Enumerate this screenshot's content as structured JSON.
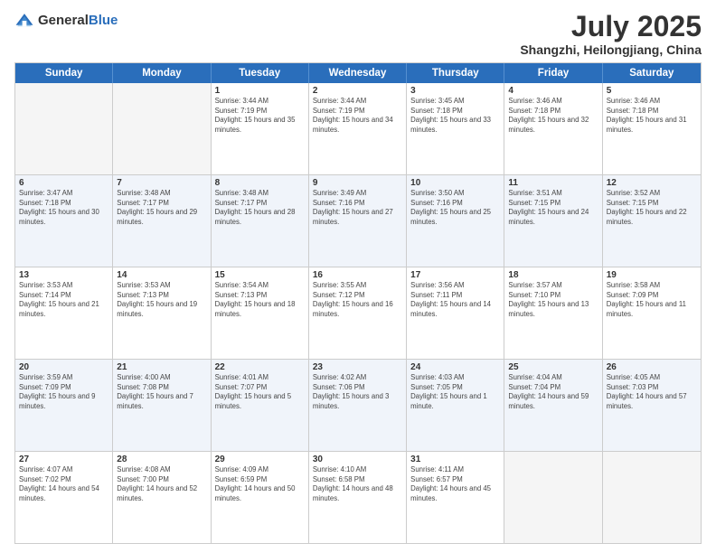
{
  "header": {
    "logo_general": "General",
    "logo_blue": "Blue",
    "title": "July 2025",
    "location": "Shangzhi, Heilongjiang, China"
  },
  "days_of_week": [
    "Sunday",
    "Monday",
    "Tuesday",
    "Wednesday",
    "Thursday",
    "Friday",
    "Saturday"
  ],
  "weeks": [
    [
      {
        "day": "",
        "sunrise": "",
        "sunset": "",
        "daylight": "",
        "empty": true
      },
      {
        "day": "",
        "sunrise": "",
        "sunset": "",
        "daylight": "",
        "empty": true
      },
      {
        "day": "1",
        "sunrise": "Sunrise: 3:44 AM",
        "sunset": "Sunset: 7:19 PM",
        "daylight": "Daylight: 15 hours and 35 minutes.",
        "empty": false
      },
      {
        "day": "2",
        "sunrise": "Sunrise: 3:44 AM",
        "sunset": "Sunset: 7:19 PM",
        "daylight": "Daylight: 15 hours and 34 minutes.",
        "empty": false
      },
      {
        "day": "3",
        "sunrise": "Sunrise: 3:45 AM",
        "sunset": "Sunset: 7:18 PM",
        "daylight": "Daylight: 15 hours and 33 minutes.",
        "empty": false
      },
      {
        "day": "4",
        "sunrise": "Sunrise: 3:46 AM",
        "sunset": "Sunset: 7:18 PM",
        "daylight": "Daylight: 15 hours and 32 minutes.",
        "empty": false
      },
      {
        "day": "5",
        "sunrise": "Sunrise: 3:46 AM",
        "sunset": "Sunset: 7:18 PM",
        "daylight": "Daylight: 15 hours and 31 minutes.",
        "empty": false
      }
    ],
    [
      {
        "day": "6",
        "sunrise": "Sunrise: 3:47 AM",
        "sunset": "Sunset: 7:18 PM",
        "daylight": "Daylight: 15 hours and 30 minutes.",
        "empty": false
      },
      {
        "day": "7",
        "sunrise": "Sunrise: 3:48 AM",
        "sunset": "Sunset: 7:17 PM",
        "daylight": "Daylight: 15 hours and 29 minutes.",
        "empty": false
      },
      {
        "day": "8",
        "sunrise": "Sunrise: 3:48 AM",
        "sunset": "Sunset: 7:17 PM",
        "daylight": "Daylight: 15 hours and 28 minutes.",
        "empty": false
      },
      {
        "day": "9",
        "sunrise": "Sunrise: 3:49 AM",
        "sunset": "Sunset: 7:16 PM",
        "daylight": "Daylight: 15 hours and 27 minutes.",
        "empty": false
      },
      {
        "day": "10",
        "sunrise": "Sunrise: 3:50 AM",
        "sunset": "Sunset: 7:16 PM",
        "daylight": "Daylight: 15 hours and 25 minutes.",
        "empty": false
      },
      {
        "day": "11",
        "sunrise": "Sunrise: 3:51 AM",
        "sunset": "Sunset: 7:15 PM",
        "daylight": "Daylight: 15 hours and 24 minutes.",
        "empty": false
      },
      {
        "day": "12",
        "sunrise": "Sunrise: 3:52 AM",
        "sunset": "Sunset: 7:15 PM",
        "daylight": "Daylight: 15 hours and 22 minutes.",
        "empty": false
      }
    ],
    [
      {
        "day": "13",
        "sunrise": "Sunrise: 3:53 AM",
        "sunset": "Sunset: 7:14 PM",
        "daylight": "Daylight: 15 hours and 21 minutes.",
        "empty": false
      },
      {
        "day": "14",
        "sunrise": "Sunrise: 3:53 AM",
        "sunset": "Sunset: 7:13 PM",
        "daylight": "Daylight: 15 hours and 19 minutes.",
        "empty": false
      },
      {
        "day": "15",
        "sunrise": "Sunrise: 3:54 AM",
        "sunset": "Sunset: 7:13 PM",
        "daylight": "Daylight: 15 hours and 18 minutes.",
        "empty": false
      },
      {
        "day": "16",
        "sunrise": "Sunrise: 3:55 AM",
        "sunset": "Sunset: 7:12 PM",
        "daylight": "Daylight: 15 hours and 16 minutes.",
        "empty": false
      },
      {
        "day": "17",
        "sunrise": "Sunrise: 3:56 AM",
        "sunset": "Sunset: 7:11 PM",
        "daylight": "Daylight: 15 hours and 14 minutes.",
        "empty": false
      },
      {
        "day": "18",
        "sunrise": "Sunrise: 3:57 AM",
        "sunset": "Sunset: 7:10 PM",
        "daylight": "Daylight: 15 hours and 13 minutes.",
        "empty": false
      },
      {
        "day": "19",
        "sunrise": "Sunrise: 3:58 AM",
        "sunset": "Sunset: 7:09 PM",
        "daylight": "Daylight: 15 hours and 11 minutes.",
        "empty": false
      }
    ],
    [
      {
        "day": "20",
        "sunrise": "Sunrise: 3:59 AM",
        "sunset": "Sunset: 7:09 PM",
        "daylight": "Daylight: 15 hours and 9 minutes.",
        "empty": false
      },
      {
        "day": "21",
        "sunrise": "Sunrise: 4:00 AM",
        "sunset": "Sunset: 7:08 PM",
        "daylight": "Daylight: 15 hours and 7 minutes.",
        "empty": false
      },
      {
        "day": "22",
        "sunrise": "Sunrise: 4:01 AM",
        "sunset": "Sunset: 7:07 PM",
        "daylight": "Daylight: 15 hours and 5 minutes.",
        "empty": false
      },
      {
        "day": "23",
        "sunrise": "Sunrise: 4:02 AM",
        "sunset": "Sunset: 7:06 PM",
        "daylight": "Daylight: 15 hours and 3 minutes.",
        "empty": false
      },
      {
        "day": "24",
        "sunrise": "Sunrise: 4:03 AM",
        "sunset": "Sunset: 7:05 PM",
        "daylight": "Daylight: 15 hours and 1 minute.",
        "empty": false
      },
      {
        "day": "25",
        "sunrise": "Sunrise: 4:04 AM",
        "sunset": "Sunset: 7:04 PM",
        "daylight": "Daylight: 14 hours and 59 minutes.",
        "empty": false
      },
      {
        "day": "26",
        "sunrise": "Sunrise: 4:05 AM",
        "sunset": "Sunset: 7:03 PM",
        "daylight": "Daylight: 14 hours and 57 minutes.",
        "empty": false
      }
    ],
    [
      {
        "day": "27",
        "sunrise": "Sunrise: 4:07 AM",
        "sunset": "Sunset: 7:02 PM",
        "daylight": "Daylight: 14 hours and 54 minutes.",
        "empty": false
      },
      {
        "day": "28",
        "sunrise": "Sunrise: 4:08 AM",
        "sunset": "Sunset: 7:00 PM",
        "daylight": "Daylight: 14 hours and 52 minutes.",
        "empty": false
      },
      {
        "day": "29",
        "sunrise": "Sunrise: 4:09 AM",
        "sunset": "Sunset: 6:59 PM",
        "daylight": "Daylight: 14 hours and 50 minutes.",
        "empty": false
      },
      {
        "day": "30",
        "sunrise": "Sunrise: 4:10 AM",
        "sunset": "Sunset: 6:58 PM",
        "daylight": "Daylight: 14 hours and 48 minutes.",
        "empty": false
      },
      {
        "day": "31",
        "sunrise": "Sunrise: 4:11 AM",
        "sunset": "Sunset: 6:57 PM",
        "daylight": "Daylight: 14 hours and 45 minutes.",
        "empty": false
      },
      {
        "day": "",
        "sunrise": "",
        "sunset": "",
        "daylight": "",
        "empty": true
      },
      {
        "day": "",
        "sunrise": "",
        "sunset": "",
        "daylight": "",
        "empty": true
      }
    ]
  ]
}
